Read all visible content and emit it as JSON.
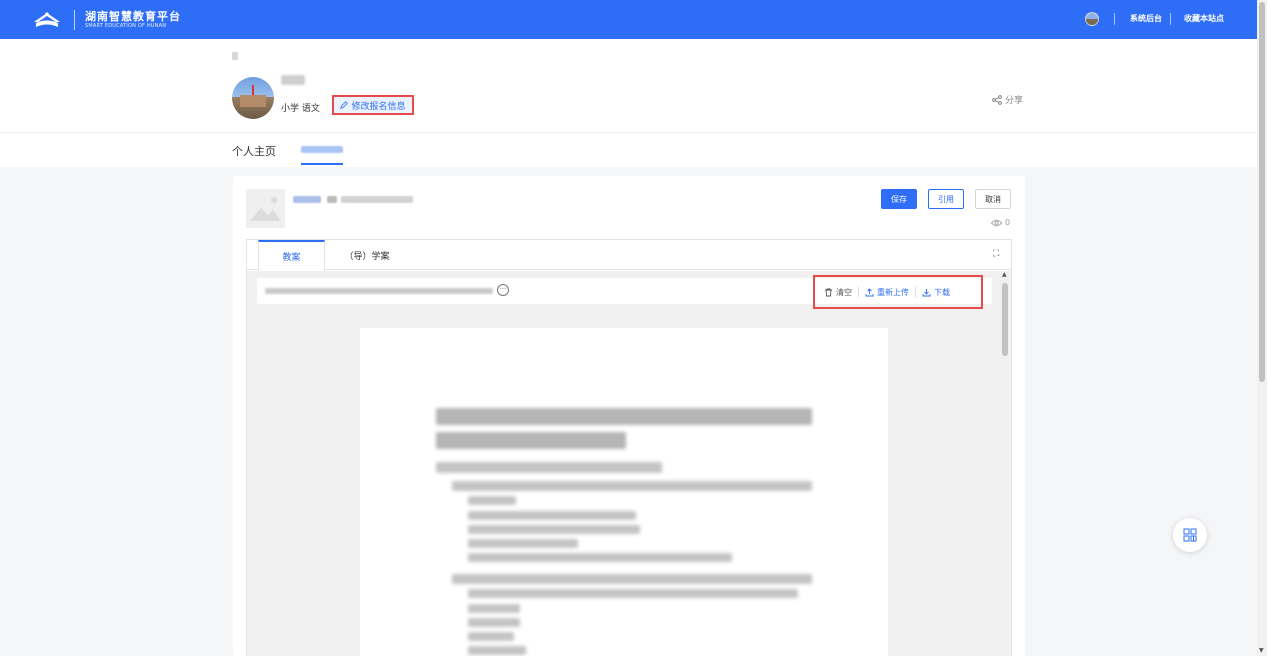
{
  "topbar": {
    "title": "湖南智慧教育平台",
    "subtitle": "SMART EDUCATION OF HUNAN",
    "admin_link": "系统后台",
    "favorite_link": "收藏本站点"
  },
  "profile": {
    "subject": "小学 语文",
    "edit_label": "修改报名信息",
    "share_label": "分享"
  },
  "tabs": {
    "home": "个人主页"
  },
  "resource": {
    "save_label": "保存",
    "quote_label": "引用",
    "cancel_label": "取消",
    "view_count": "0"
  },
  "doc_tabs": {
    "lesson_plan": "教案",
    "study_plan": "（导）学案"
  },
  "file_actions": {
    "clear": "清空",
    "reupload": "重新上传",
    "download": "下载"
  },
  "colors": {
    "brand": "#2e6df6",
    "highlight": "#e64a4a"
  }
}
